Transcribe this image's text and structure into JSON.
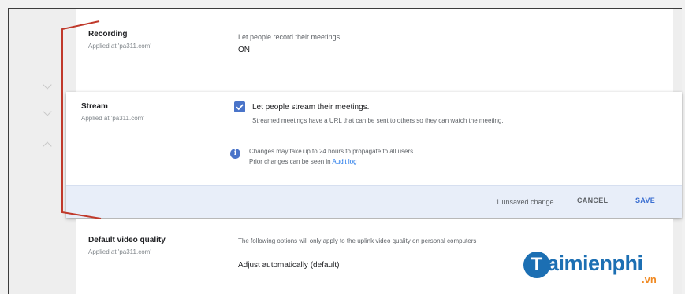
{
  "recording": {
    "title": "Recording",
    "applied": "Applied at 'pa311.com'",
    "description": "Let people record their meetings.",
    "value": "ON"
  },
  "stream": {
    "title": "Stream",
    "applied": "Applied at 'pa311.com'",
    "checkbox_label": "Let people stream their meetings.",
    "checkbox_checked": true,
    "checkbox_help": "Streamed meetings have a URL that can be sent to others so they can watch the meeting.",
    "info_line1": "Changes may take up to 24 hours to propagate to all users.",
    "info_line2_prefix": "Prior changes can be seen in ",
    "audit_log_link": "Audit log"
  },
  "footer": {
    "unsaved": "1 unsaved change",
    "cancel_label": "CANCEL",
    "save_label": "SAVE"
  },
  "video_quality": {
    "title": "Default video quality",
    "applied": "Applied at 'pa311.com'",
    "description": "The following options will only apply to the uplink video quality on personal computers",
    "value": "Adjust automatically (default)"
  },
  "watermark": {
    "letter": "T",
    "word": "aimienphi",
    "suffix": ".vn"
  },
  "colors": {
    "accent": "#4a74c9",
    "annotation": "#c0392b",
    "footer_bg": "#e8eef9"
  }
}
